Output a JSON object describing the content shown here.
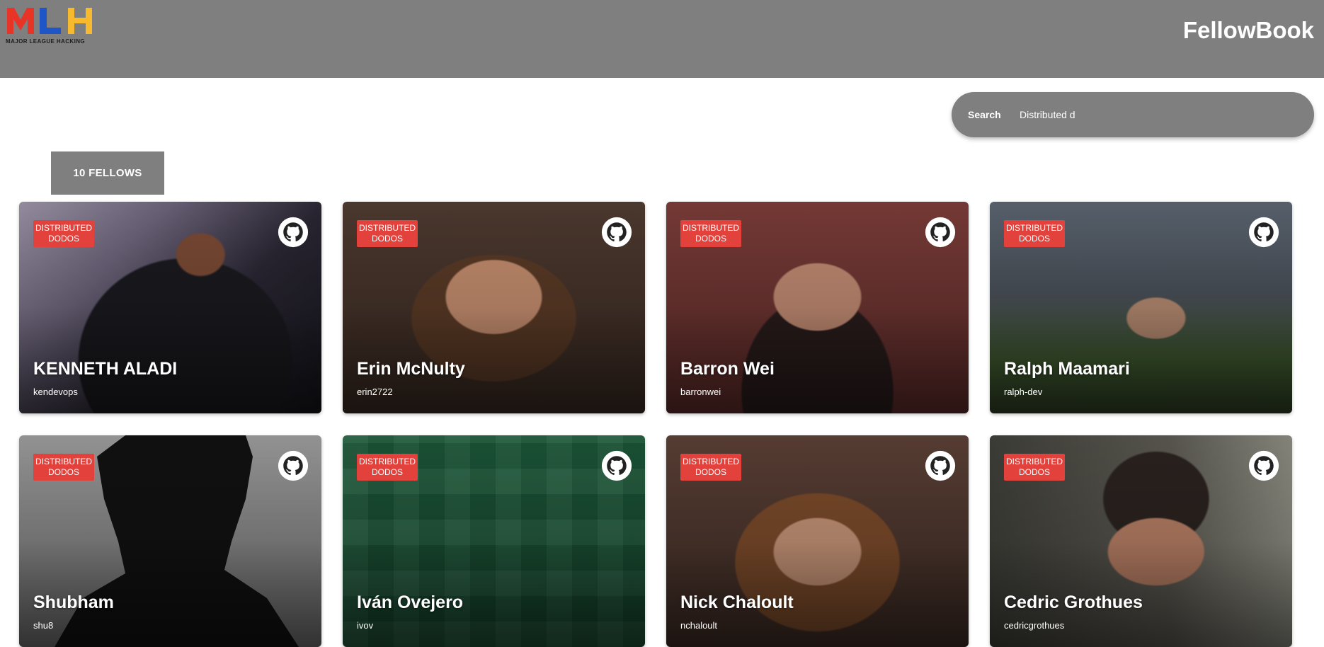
{
  "header": {
    "logo_text": "MLH",
    "logo_subtitle": "MAJOR LEAGUE HACKING",
    "logo_letters": [
      {
        "char": "M",
        "color": "#e73427"
      },
      {
        "char": "L",
        "color": "#1e56c7"
      },
      {
        "char": "H",
        "color": "#f7b92d"
      }
    ],
    "title": "FellowBook"
  },
  "search": {
    "label": "Search",
    "value": "Distributed d"
  },
  "count_label": "10 FELLOWS",
  "colors": {
    "header_bg": "#7f7f7f",
    "tag_bg": "#e2413c"
  },
  "cards": [
    {
      "name": "KENNETH ALADI",
      "handle": "kendevops",
      "tag_line1": "DISTRIBUTED",
      "tag_line2": "DODOS",
      "photo": "dark-hoodie"
    },
    {
      "name": "Erin McNulty",
      "handle": "erin2722",
      "tag_line1": "DISTRIBUTED",
      "tag_line2": "DODOS",
      "photo": "portrait-warm"
    },
    {
      "name": "Barron Wei",
      "handle": "barronwei",
      "tag_line1": "DISTRIBUTED",
      "tag_line2": "DODOS",
      "photo": "illustrated-red"
    },
    {
      "name": "Ralph Maamari",
      "handle": "ralph-dev",
      "tag_line1": "DISTRIBUTED",
      "tag_line2": "DODOS",
      "photo": "campus"
    },
    {
      "name": "Shubham",
      "handle": "shu8",
      "tag_line1": "DISTRIBUTED",
      "tag_line2": "DODOS",
      "photo": "silhouette"
    },
    {
      "name": "Iván Ovejero",
      "handle": "ivov",
      "tag_line1": "DISTRIBUTED",
      "tag_line2": "DODOS",
      "photo": "green-pattern"
    },
    {
      "name": "Nick Chaloult",
      "handle": "nchaloult",
      "tag_line1": "DISTRIBUTED",
      "tag_line2": "DODOS",
      "photo": "brick-wall"
    },
    {
      "name": "Cedric Grothues",
      "handle": "cedricgrothues",
      "tag_line1": "DISTRIBUTED",
      "tag_line2": "DODOS",
      "photo": "outdoor"
    }
  ]
}
